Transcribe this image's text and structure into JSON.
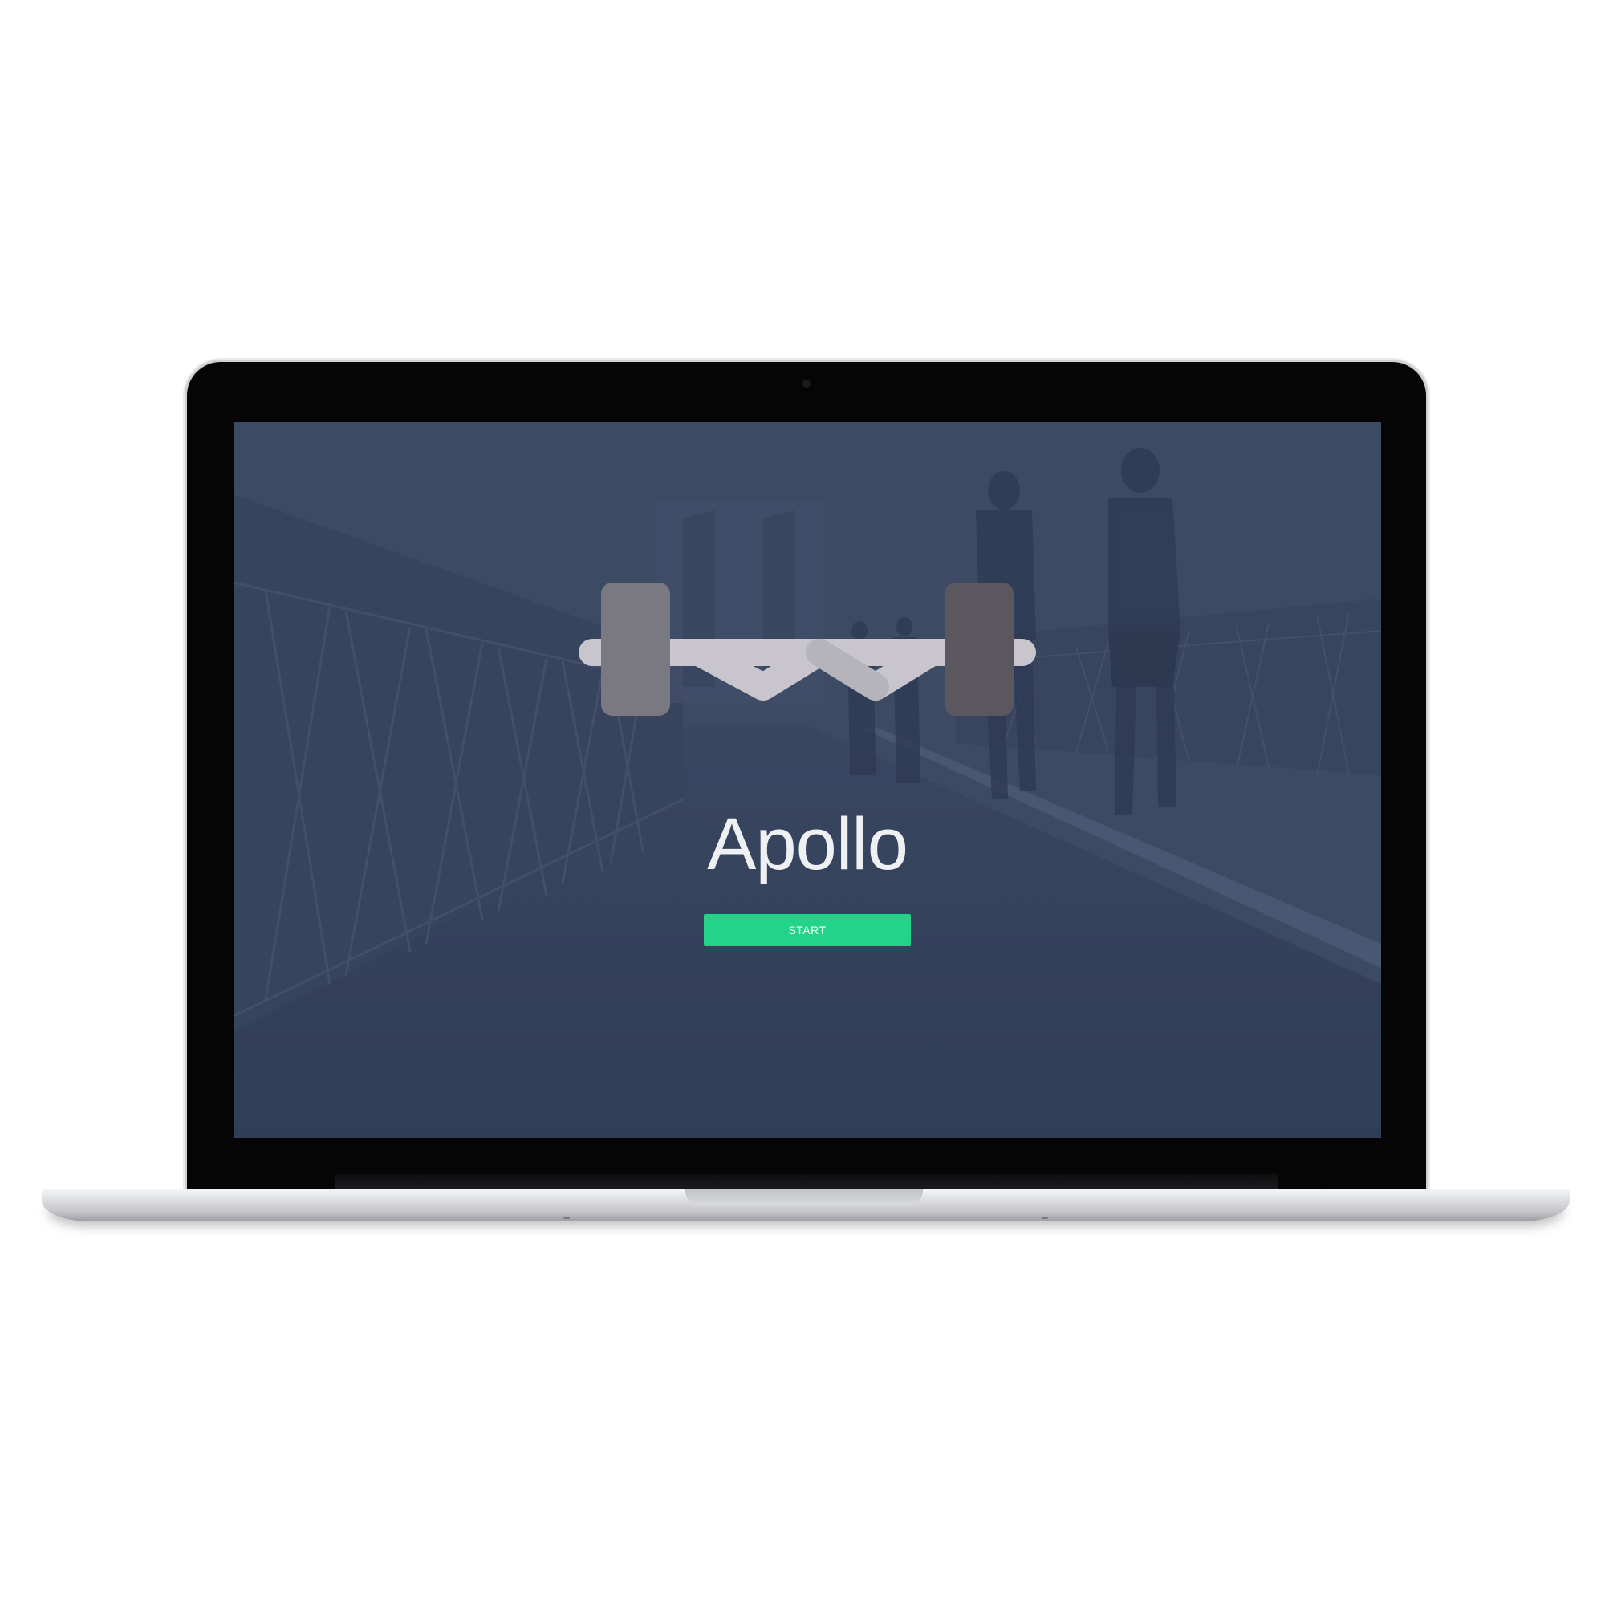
{
  "app": {
    "title": "Apollo",
    "start_label": "START"
  },
  "colors": {
    "accent": "#24d38a",
    "overlay": "#3a475f",
    "title_text": "#eef0f4",
    "logo_light_plate": "#7a7880",
    "logo_dark_plate": "#5a585e",
    "logo_bar": "#c8c6cc"
  },
  "icons": {
    "logo": "barbell-icon",
    "camera": "camera-icon"
  }
}
